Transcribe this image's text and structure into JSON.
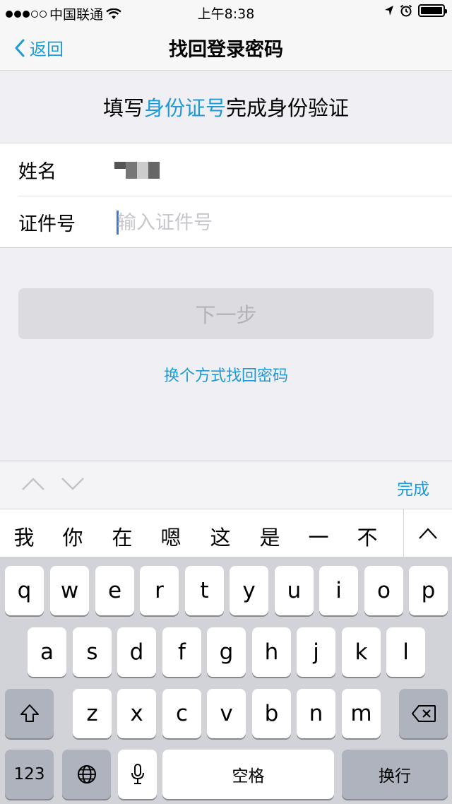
{
  "status_bar": {
    "carrier": "中国联通",
    "time": "上午8:38"
  },
  "nav": {
    "back_label": "返回",
    "title": "找回登录密码"
  },
  "instruction": {
    "prefix": "填写",
    "highlight": "身份证号",
    "suffix": "完成身份验证"
  },
  "form": {
    "name_label": "姓名",
    "id_label": "证件号",
    "id_placeholder": "输入证件号",
    "id_value": ""
  },
  "actions": {
    "next_label": "下一步",
    "alt_link": "换个方式找回密码"
  },
  "accessory": {
    "done_label": "完成"
  },
  "candidates": [
    "我",
    "你",
    "在",
    "嗯",
    "这",
    "是",
    "一",
    "不"
  ],
  "keyboard": {
    "row1": [
      "q",
      "w",
      "e",
      "r",
      "t",
      "y",
      "u",
      "i",
      "o",
      "p"
    ],
    "row2": [
      "a",
      "s",
      "d",
      "f",
      "g",
      "h",
      "j",
      "k",
      "l"
    ],
    "row3": [
      "z",
      "x",
      "c",
      "v",
      "b",
      "n",
      "m"
    ],
    "numbers_label": "123",
    "space_label": "空格",
    "return_label": "换行"
  },
  "colors": {
    "accent": "#1e9bd7",
    "background": "#efeff4",
    "keyboard_bg": "#d1d3d9"
  }
}
